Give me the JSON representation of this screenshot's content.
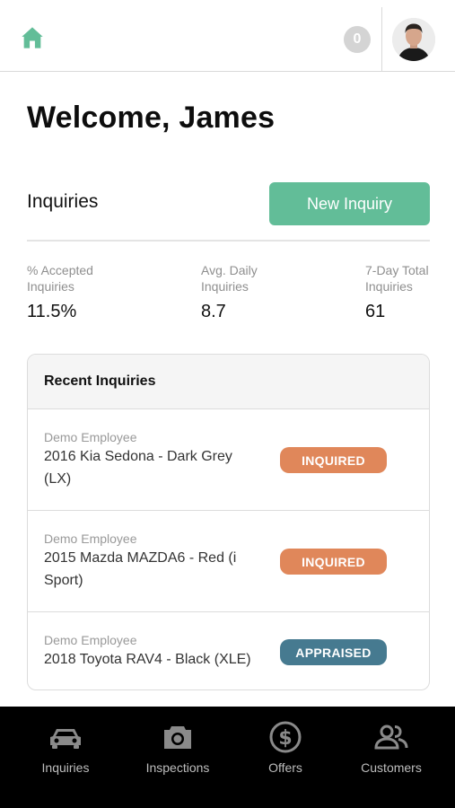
{
  "header": {
    "home_icon": "home-icon",
    "notification_count": "0",
    "avatar_icon": "user-avatar"
  },
  "welcome": "Welcome, James",
  "inquiries": {
    "title": "Inquiries",
    "new_button": "New Inquiry"
  },
  "stats": [
    {
      "label": "% Accepted Inquiries",
      "value": "11.5%"
    },
    {
      "label": "Avg. Daily Inquiries",
      "value": "8.7"
    },
    {
      "label": "7-Day Total Inquiries",
      "value": "61"
    }
  ],
  "recent": {
    "title": "Recent Inquiries",
    "rows": [
      {
        "employee": "Demo Employee",
        "vehicle": "2016 Kia Sedona - Dark Grey (LX)",
        "status": "INQUIRED",
        "status_color": "#e0875a"
      },
      {
        "employee": "Demo Employee",
        "vehicle": "2015 Mazda MAZDA6 - Red (i Sport)",
        "status": "INQUIRED",
        "status_color": "#e0875a"
      },
      {
        "employee": "Demo Employee",
        "vehicle": "2018 Toyota RAV4 - Black (XLE)",
        "status": "APPRAISED",
        "status_color": "#467a90"
      }
    ]
  },
  "tabs": [
    {
      "label": "Inquiries",
      "icon": "car-icon"
    },
    {
      "label": "Inspections",
      "icon": "camera-icon"
    },
    {
      "label": "Offers",
      "icon": "dollar-circle-icon"
    },
    {
      "label": "Customers",
      "icon": "people-icon"
    }
  ],
  "colors": {
    "accent": "#62bd98",
    "inquired": "#e0875a",
    "appraised": "#467a90"
  }
}
